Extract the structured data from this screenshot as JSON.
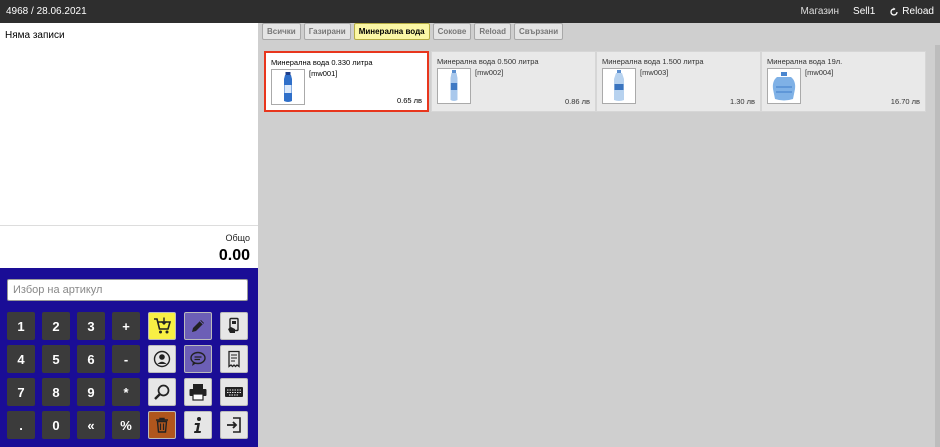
{
  "topbar": {
    "left_text": "4968 / 28.06.2021",
    "store_label": "Магазин",
    "user_label": "Sell1",
    "reload_label": "Reload",
    "reload_icon": "reload-icon"
  },
  "receipt": {
    "empty_text": "Няма записи",
    "total_label": "Общо",
    "total_value": "0.00"
  },
  "search": {
    "placeholder": "Избор на артикул"
  },
  "keypad": {
    "rows": [
      [
        {
          "type": "num",
          "label": "1"
        },
        {
          "type": "num",
          "label": "2"
        },
        {
          "type": "num",
          "label": "3"
        },
        {
          "type": "num",
          "label": "+"
        },
        {
          "type": "icon",
          "icon": "add-to-cart-icon",
          "bg": "#f8f044"
        },
        {
          "type": "icon",
          "icon": "pencil-icon",
          "bg": "#6c5fb6"
        },
        {
          "type": "icon",
          "icon": "payment-card-icon",
          "bg": "#e6e6e6"
        }
      ],
      [
        {
          "type": "num",
          "label": "4"
        },
        {
          "type": "num",
          "label": "5"
        },
        {
          "type": "num",
          "label": "6"
        },
        {
          "type": "num",
          "label": "-"
        },
        {
          "type": "icon",
          "icon": "user-icon",
          "bg": "#e6e6e6"
        },
        {
          "type": "icon",
          "icon": "comment-icon",
          "bg": "#6c5fb6"
        },
        {
          "type": "icon",
          "icon": "receipt-icon",
          "bg": "#e6e6e6"
        }
      ],
      [
        {
          "type": "num",
          "label": "7"
        },
        {
          "type": "num",
          "label": "8"
        },
        {
          "type": "num",
          "label": "9"
        },
        {
          "type": "num",
          "label": "*"
        },
        {
          "type": "icon",
          "icon": "search-icon",
          "bg": "#e6e6e6"
        },
        {
          "type": "icon",
          "icon": "printer-icon",
          "bg": "#e6e6e6"
        },
        {
          "type": "icon",
          "icon": "keyboard-icon",
          "bg": "#e6e6e6"
        }
      ],
      [
        {
          "type": "num",
          "label": "."
        },
        {
          "type": "num",
          "label": "0"
        },
        {
          "type": "num",
          "label": "«"
        },
        {
          "type": "num",
          "label": "%"
        },
        {
          "type": "icon",
          "icon": "trash-icon",
          "bg": "#b0561d"
        },
        {
          "type": "icon",
          "icon": "info-icon",
          "bg": "#e6e6e6"
        },
        {
          "type": "icon",
          "icon": "exit-icon",
          "bg": "#e6e6e6"
        }
      ]
    ]
  },
  "tabs": [
    {
      "label": "Всички",
      "active": false
    },
    {
      "label": "Газирани",
      "active": false
    },
    {
      "label": "Минерална вода",
      "active": true
    },
    {
      "label": "Сокове",
      "active": false
    },
    {
      "label": "Reload",
      "active": false
    },
    {
      "label": "Свързани",
      "active": false
    }
  ],
  "products": [
    {
      "name": "Минерална вода 0.330 литра",
      "code": "[mw001]",
      "price": "0.65 лв",
      "selected": true,
      "icon": "small-bottle-icon"
    },
    {
      "name": "Минерална вода 0.500 литра",
      "code": "[mw002]",
      "price": "0.86 лв",
      "selected": false,
      "icon": "bottle-icon"
    },
    {
      "name": "Минерална вода 1.500 литра",
      "code": "[mw003]",
      "price": "1.30 лв",
      "selected": false,
      "icon": "large-bottle-icon"
    },
    {
      "name": "Минерална вода 19л.",
      "code": "[mw004]",
      "price": "16.70 лв",
      "selected": false,
      "icon": "water-jug-icon"
    }
  ]
}
